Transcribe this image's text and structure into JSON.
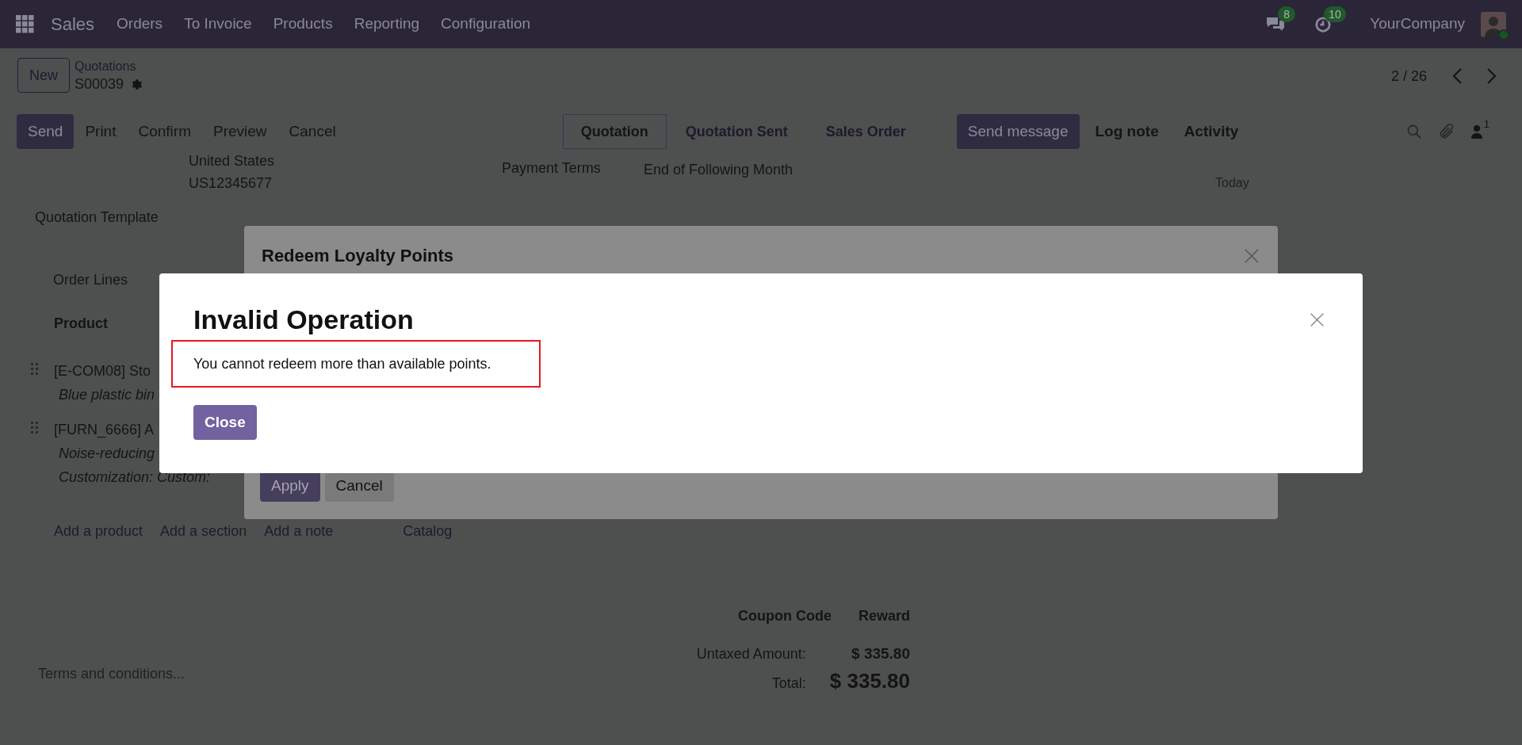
{
  "navbar": {
    "app": "Sales",
    "menu": [
      "Orders",
      "To Invoice",
      "Products",
      "Reporting",
      "Configuration"
    ],
    "messages_count": "8",
    "activities_count": "10",
    "company": "YourCompany"
  },
  "control_panel": {
    "new_button": "New",
    "breadcrumb": "Quotations",
    "record": "S00039",
    "pager": "2 / 26"
  },
  "actions": [
    {
      "label": "Send",
      "primary": true
    },
    {
      "label": "Print",
      "primary": false
    },
    {
      "label": "Confirm",
      "primary": false
    },
    {
      "label": "Preview",
      "primary": false
    },
    {
      "label": "Cancel",
      "primary": false
    }
  ],
  "status_bar": [
    {
      "label": "Quotation",
      "selected": true
    },
    {
      "label": "Quotation Sent",
      "selected": false
    },
    {
      "label": "Sales Order",
      "selected": false
    }
  ],
  "chatter": {
    "buttons": [
      {
        "label": "Send message",
        "primary": true
      },
      {
        "label": "Log note",
        "primary": false
      },
      {
        "label": "Activity",
        "primary": false
      }
    ],
    "followers": "1",
    "date": "Today"
  },
  "form": {
    "address_lines": [
      "United States",
      "US12345677"
    ],
    "payment_terms": {
      "label": "Payment Terms",
      "value": "End of Following Month"
    },
    "quotation_template": "Quotation Template",
    "tab": "Order Lines",
    "column": "Product",
    "lines": [
      {
        "name": "[E-COM08] Sto",
        "notes": [
          "Blue plastic bin"
        ]
      },
      {
        "name": "[FURN_6666] A",
        "notes": [
          "Noise-reducing",
          "Customization: Custom:"
        ]
      }
    ],
    "add_links": [
      "Add a product",
      "Add a section",
      "Add a note",
      "Catalog"
    ],
    "terms_placeholder": "Terms and conditions...",
    "coupon_buttons": [
      "Coupon Code",
      "Reward"
    ],
    "totals": [
      {
        "label": "Untaxed Amount:",
        "value": "$ 335.80",
        "kind": "subtotal"
      },
      {
        "label": "Total:",
        "value": "$ 335.80",
        "kind": "total"
      }
    ]
  },
  "redeem_dialog": {
    "title": "Redeem Loyalty Points",
    "buttons": [
      {
        "label": "Apply",
        "primary": true
      },
      {
        "label": "Cancel",
        "primary": false
      }
    ]
  },
  "error_dialog": {
    "title": "Invalid Operation",
    "message": "You cannot redeem more than available points.",
    "button": "Close"
  }
}
